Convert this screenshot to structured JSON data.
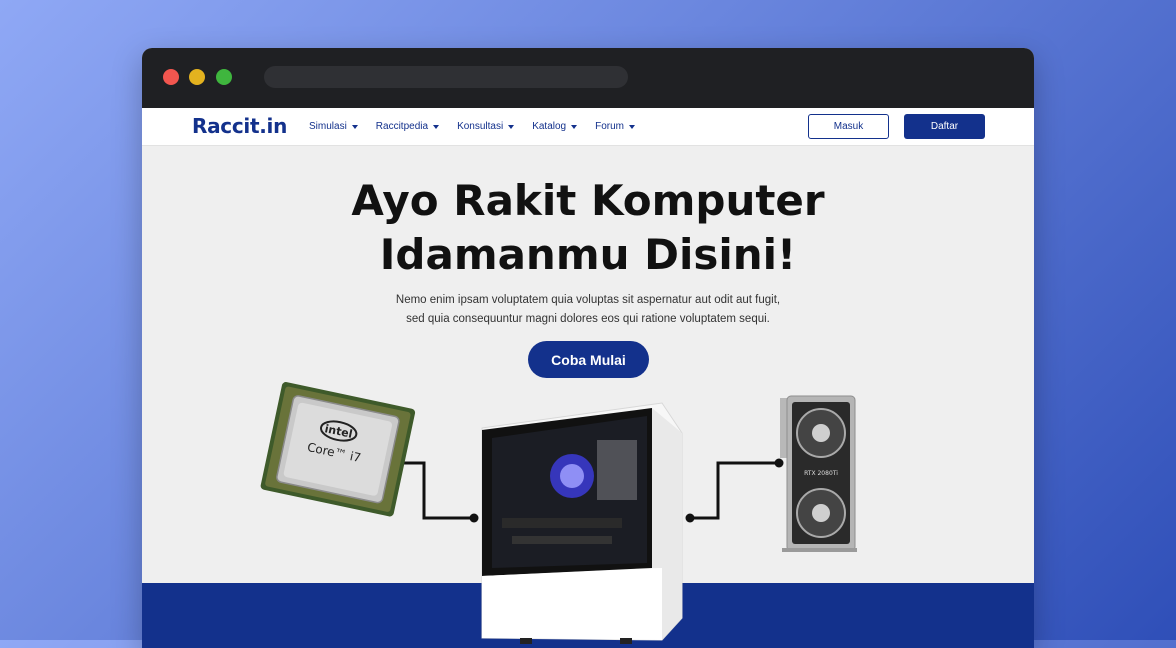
{
  "navbar": {
    "logo": "Raccit.in",
    "items": [
      {
        "label": "Simulasi"
      },
      {
        "label": "Raccitpedia"
      },
      {
        "label": "Konsultasi"
      },
      {
        "label": "Katalog"
      },
      {
        "label": "Forum"
      }
    ],
    "masuk_label": "Masuk",
    "daftar_label": "Daftar"
  },
  "hero": {
    "title_line1": "Ayo Rakit Komputer",
    "title_line2": "Idamanmu Disini!",
    "subtitle_line1": "Nemo enim ipsam voluptatem quia voluptas sit aspernatur aut odit aut fugit,",
    "subtitle_line2": "sed quia consequuntur magni dolores eos qui ratione voluptatem sequi.",
    "cta_label": "Coba Mulai"
  },
  "illustration": {
    "cpu_brand": "intel",
    "cpu_model": "Core™ i7",
    "gpu_label": "RTX 2080Ti"
  },
  "colors": {
    "brand": "#13318c",
    "window_bg": "#efefef",
    "titlebar": "#1f2023"
  }
}
